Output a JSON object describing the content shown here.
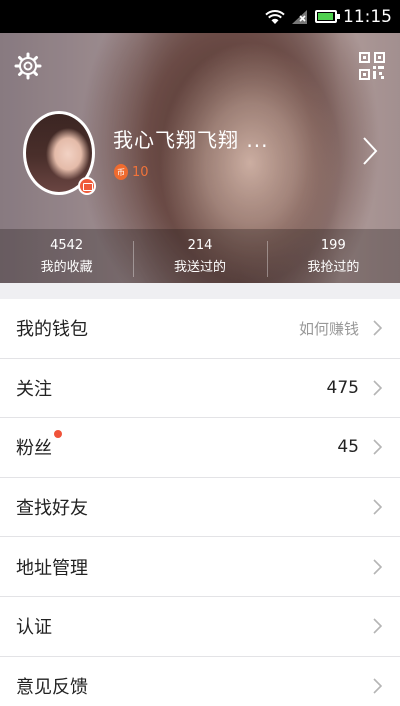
{
  "status_bar": {
    "time": "11:15"
  },
  "profile": {
    "nickname": "我心飞翔飞翔 ...",
    "coin_value": "10",
    "coin_icon_char": "币"
  },
  "stats": [
    {
      "count": "4542",
      "label": "我的收藏"
    },
    {
      "count": "214",
      "label": "我送过的"
    },
    {
      "count": "199",
      "label": "我抢过的"
    }
  ],
  "menu": [
    {
      "label": "我的钱包",
      "value": "如何赚钱"
    },
    {
      "label": "关注",
      "value": "475"
    },
    {
      "label": "粉丝",
      "value": "45",
      "has_notification": true
    },
    {
      "label": "查找好友"
    },
    {
      "label": "地址管理"
    },
    {
      "label": "认证"
    },
    {
      "label": "意见反馈"
    }
  ],
  "colors": {
    "accent": "#ef6b2f",
    "notification_dot": "#f0533a",
    "battery_fill": "#4fd04f"
  }
}
